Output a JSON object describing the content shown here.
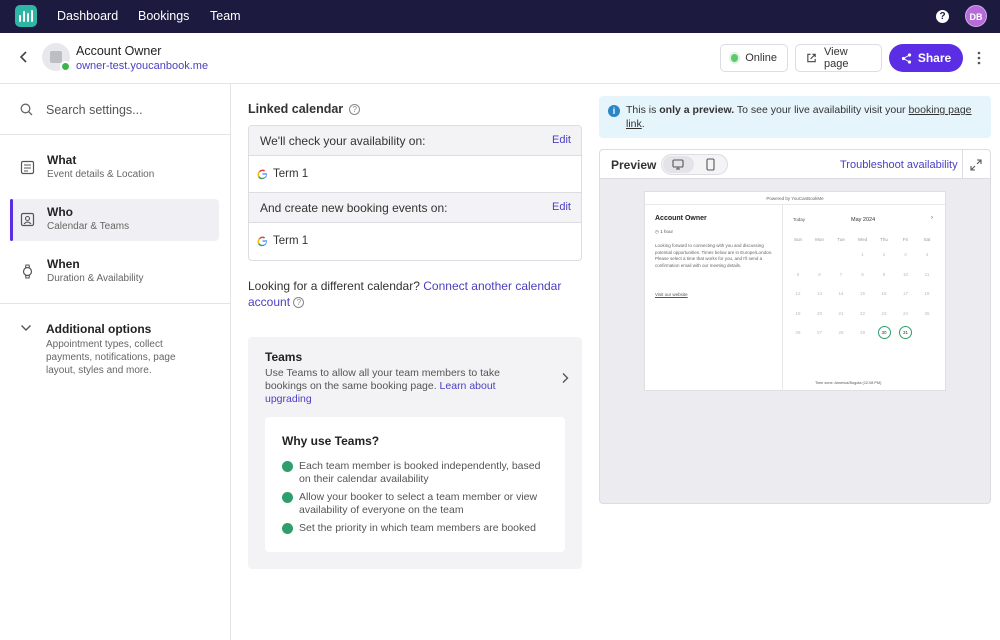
{
  "nav": {
    "items": [
      "Dashboard",
      "Bookings",
      "Team"
    ],
    "help_icon": "question-circle-icon",
    "avatar_initials": "DB"
  },
  "header": {
    "account_name": "Account Owner",
    "account_url": "owner-test.youcanbook.me",
    "online_label": "Online",
    "view_page_label": "View page",
    "share_label": "Share"
  },
  "sidebar": {
    "search_placeholder": "Search settings...",
    "items": [
      {
        "title": "What",
        "subtitle": "Event details & Location",
        "icon": "document-icon"
      },
      {
        "title": "Who",
        "subtitle": "Calendar & Teams",
        "icon": "user-card-icon"
      },
      {
        "title": "When",
        "subtitle": "Duration & Availability",
        "icon": "watch-icon"
      }
    ],
    "additional": {
      "title": "Additional options",
      "subtitle": "Appointment types, collect payments, notifications, page layout, styles and more."
    }
  },
  "linked_calendar": {
    "title": "Linked calendar",
    "check_label": "We'll check your availability on:",
    "create_label": "And create new booking events on:",
    "edit_label": "Edit",
    "check_calendar": "Term 1",
    "create_calendar": "Term 1",
    "different_text": "Looking for a different calendar?",
    "connect_link": "Connect another calendar account"
  },
  "teams": {
    "title": "Teams",
    "desc": "Use Teams to allow all your team members to take bookings on the same booking page.",
    "learn_link": "Learn about upgrading",
    "why_title": "Why use Teams?",
    "why_items": [
      "Each team member is booked independently, based on their calendar availability",
      "Allow your booker to select a team member or view availability of everyone on the team",
      "Set the priority in which team members are booked"
    ]
  },
  "notice": {
    "prefix": "This is",
    "bold": "only a preview.",
    "middle": "To see your live availability visit your",
    "link": "booking page link",
    "suffix": "."
  },
  "preview": {
    "label": "Preview",
    "troubleshoot": "Troubleshoot availability",
    "mini": {
      "powered": "Powered by YouCanBookMe",
      "owner": "Account Owner",
      "duration": "1 hour",
      "text": "Looking forward to connecting with you and discussing potential opportunities. Times below are in Europe/London. Please select a time that works for you, and I'll send a confirmation email with our meeting details.",
      "visit": "Visit our website",
      "today": "Today",
      "month": "May 2024",
      "days": [
        "Sun",
        "Mon",
        "Tue",
        "Wed",
        "Thu",
        "Fri",
        "Sat"
      ],
      "rows": [
        [
          "",
          "",
          "",
          "1",
          "2",
          "3",
          "4"
        ],
        [
          "5",
          "6",
          "7",
          "8",
          "9",
          "10",
          "11"
        ],
        [
          "12",
          "13",
          "14",
          "15",
          "16",
          "17",
          "18"
        ],
        [
          "19",
          "20",
          "21",
          "22",
          "23",
          "24",
          "25"
        ],
        [
          "26",
          "27",
          "28",
          "29",
          "30",
          "31",
          ""
        ]
      ],
      "available": [
        "30",
        "31"
      ],
      "timezone": "Time zone: America/Bogota (12:08 PM)"
    }
  }
}
